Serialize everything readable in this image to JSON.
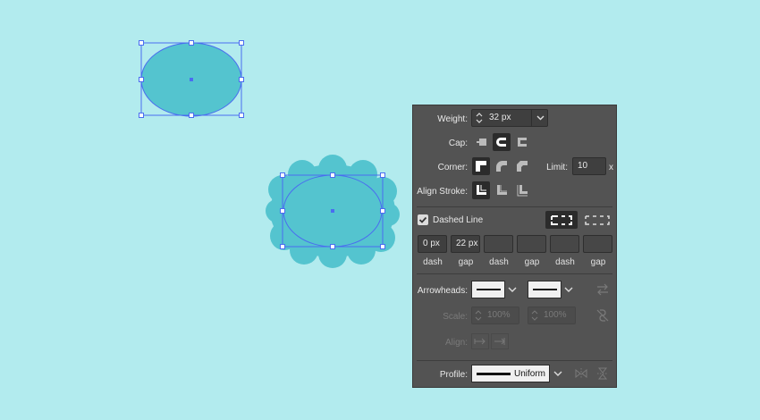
{
  "stroke_panel": {
    "weight": {
      "label": "Weight:",
      "value": "32 px"
    },
    "cap": {
      "label": "Cap:",
      "selected": "round-cap"
    },
    "corner": {
      "label": "Corner:",
      "limit_label": "Limit:",
      "limit_value": "10",
      "limit_unit": "x"
    },
    "align_stroke": {
      "label": "Align Stroke:"
    },
    "dashed_line": {
      "label": "Dashed Line",
      "checked": true
    },
    "dash_fields": [
      {
        "value": "0 px",
        "label": "dash"
      },
      {
        "value": "22 px",
        "label": "gap"
      },
      {
        "value": "",
        "label": "dash"
      },
      {
        "value": "",
        "label": "gap"
      },
      {
        "value": "",
        "label": "dash"
      },
      {
        "value": "",
        "label": "gap"
      }
    ],
    "arrowheads": {
      "label": "Arrowheads:"
    },
    "scale": {
      "label": "Scale:",
      "start": "100%",
      "end": "100%"
    },
    "align": {
      "label": "Align:"
    },
    "profile": {
      "label": "Profile:",
      "value": "Uniform"
    }
  },
  "colors": {
    "canvas": "#b2ebee",
    "shape_fill": "#54c4cf",
    "selection": "#4a6df0",
    "panel_bg": "#535353"
  }
}
